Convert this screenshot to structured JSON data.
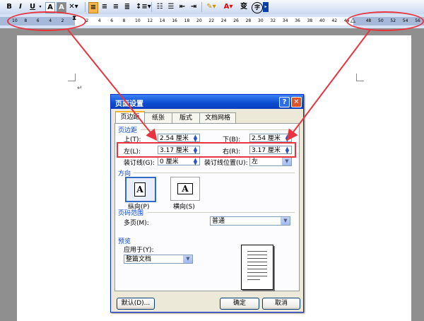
{
  "toolbar": {
    "bold": "B",
    "italic": "I",
    "underline": "U",
    "font_a1": "A",
    "font_a2": "A",
    "colors": {
      "highlight": "#ffff00",
      "font": "#ff0000"
    }
  },
  "ruler": {
    "left_numbers": [
      "10",
      "8",
      "6",
      "4",
      "2"
    ],
    "mid_numbers": [
      "2",
      "4",
      "6",
      "8",
      "10",
      "12",
      "14",
      "16",
      "18",
      "20",
      "22",
      "24",
      "26",
      "28",
      "30",
      "32",
      "34",
      "36",
      "38",
      "40",
      "42",
      "44"
    ],
    "right_numbers": [
      "48",
      "50",
      "52",
      "54",
      "56"
    ]
  },
  "dialog": {
    "title": "页面设置",
    "help": "?",
    "close": "✕",
    "tabs": [
      "页边距",
      "纸张",
      "版式",
      "文档网格"
    ],
    "margins_group": "页边距",
    "top_label": "上(T):",
    "top_value": "2.54 厘米",
    "bottom_label": "下(B):",
    "bottom_value": "2.54 厘米",
    "left_label": "左(L):",
    "left_value": "3.17 厘米",
    "right_label": "右(R):",
    "right_value": "3.17 厘米",
    "gutter_label": "装订线(G):",
    "gutter_value": "0 厘米",
    "gutter_pos_label": "装订线位置(U):",
    "gutter_pos_value": "左",
    "orientation_group": "方向",
    "portrait_label": "纵向(P)",
    "landscape_label": "横向(S)",
    "pages_group": "页码范围",
    "multi_pages_label": "多页(M):",
    "multi_pages_value": "普通",
    "preview_group": "预览",
    "apply_label": "应用于(Y):",
    "apply_value": "整篇文档",
    "default_btn": "默认(D)...",
    "ok_btn": "确定",
    "cancel_btn": "取消"
  }
}
